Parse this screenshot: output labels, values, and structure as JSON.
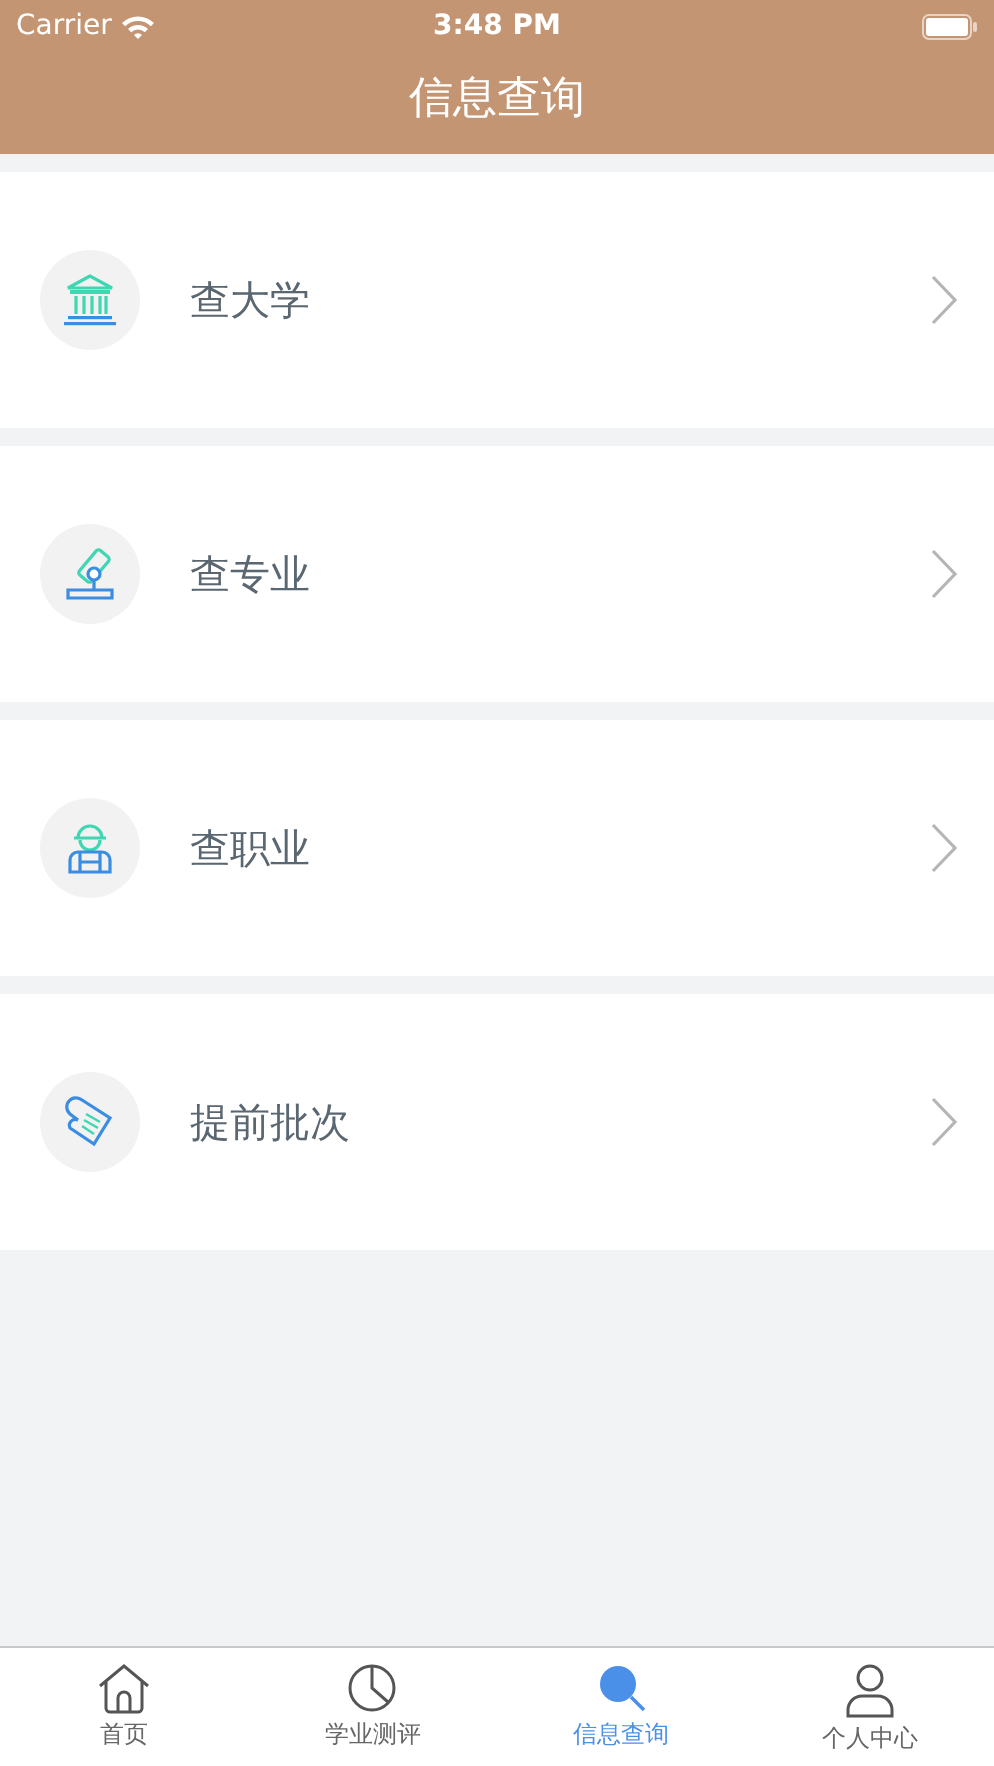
{
  "status_bar": {
    "carrier": "Carrier",
    "time": "3:48 PM"
  },
  "nav": {
    "title": "信息查询"
  },
  "items": [
    {
      "kind": "bank",
      "label": "查大学"
    },
    {
      "kind": "microscope",
      "label": "查专业"
    },
    {
      "kind": "worker",
      "label": "查职业"
    },
    {
      "kind": "scroll",
      "label": "提前批次"
    }
  ],
  "tabs": [
    {
      "kind": "home",
      "label": "首页",
      "selected": false
    },
    {
      "kind": "chart",
      "label": "学业测评",
      "selected": false
    },
    {
      "kind": "search",
      "label": "信息查询",
      "selected": true
    },
    {
      "kind": "person",
      "label": "个人中心",
      "selected": false
    }
  ]
}
